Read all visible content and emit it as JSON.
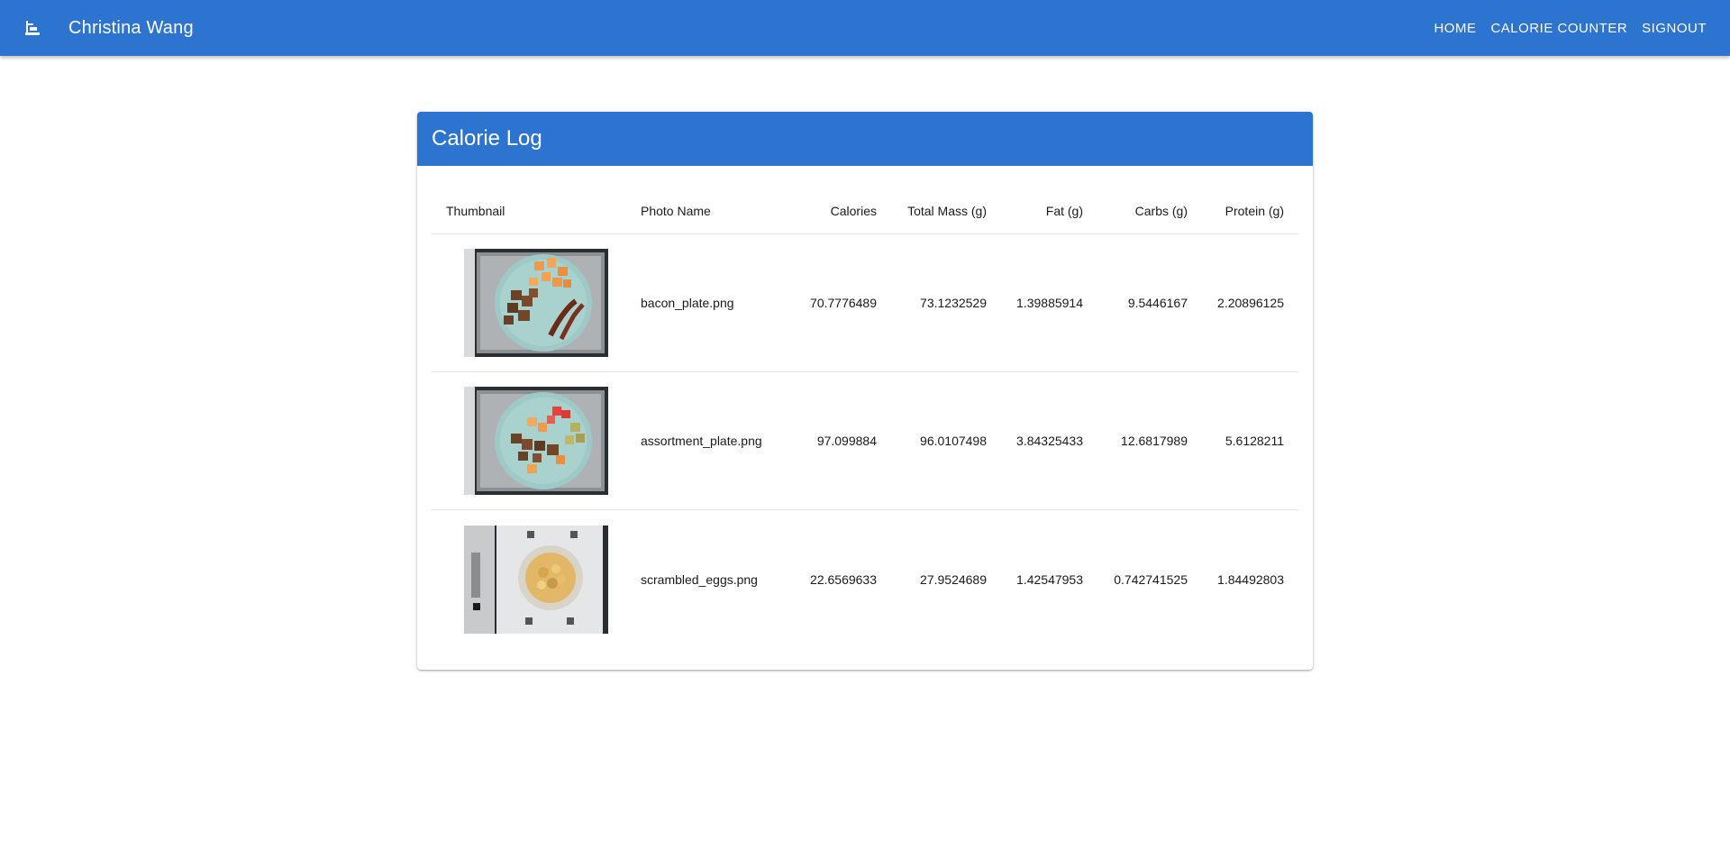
{
  "appbar": {
    "title": "Christina Wang",
    "logo_icon": "scale-icon",
    "nav": [
      "HOME",
      "CALORIE COUNTER",
      "SIGNOUT"
    ],
    "color": "#2c74d0"
  },
  "card": {
    "title": "Calorie Log",
    "columns": [
      "Thumbnail",
      "Photo Name",
      "Calories",
      "Total Mass (g)",
      "Fat (g)",
      "Carbs (g)",
      "Protein (g)"
    ],
    "rows": [
      {
        "thumb": "bacon-plate-thumbnail",
        "name": "bacon_plate.png",
        "calories": "70.7776489",
        "mass": "73.1232529",
        "fat": "1.39885914",
        "carbs": "9.5446167",
        "protein": "2.20896125"
      },
      {
        "thumb": "assortment-plate-thumbnail",
        "name": "assortment_plate.png",
        "calories": "97.099884",
        "mass": "96.0107498",
        "fat": "3.84325433",
        "carbs": "12.6817989",
        "protein": "5.6128211"
      },
      {
        "thumb": "scrambled-eggs-thumbnail",
        "name": "scrambled_eggs.png",
        "calories": "22.6569633",
        "mass": "27.9524689",
        "fat": "1.42547953",
        "carbs": "0.742741525",
        "protein": "1.84492803"
      }
    ]
  }
}
